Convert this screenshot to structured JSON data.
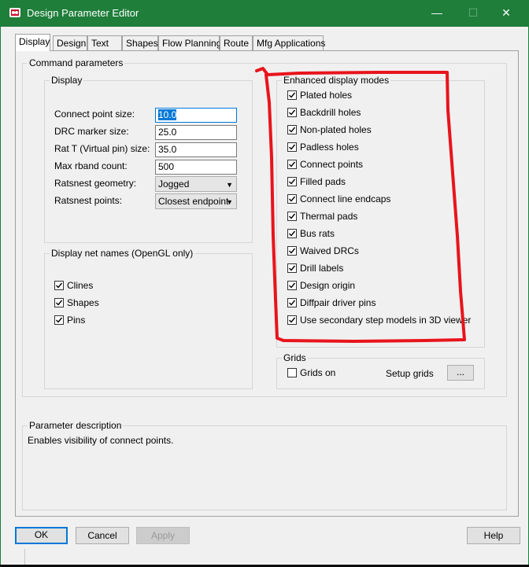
{
  "window": {
    "title": "Design Parameter Editor"
  },
  "tabs": [
    "Display",
    "Design",
    "Text",
    "Shapes",
    "Flow Planning",
    "Route",
    "Mfg Applications"
  ],
  "command_parameters": {
    "legend": "Command parameters",
    "display": {
      "legend": "Display",
      "fields": [
        {
          "label": "Connect point size:",
          "value": "10.0"
        },
        {
          "label": "DRC marker size:",
          "value": "25.0"
        },
        {
          "label": "Rat T (Virtual pin) size:",
          "value": "35.0"
        },
        {
          "label": "Max rband count:",
          "value": "500"
        },
        {
          "label": "Ratsnest geometry:",
          "value": "Jogged"
        },
        {
          "label": "Ratsnest points:",
          "value": "Closest endpoint"
        }
      ]
    },
    "net_names": {
      "legend": "Display net names (OpenGL only)",
      "items": [
        {
          "label": "Clines",
          "checked": true
        },
        {
          "label": "Shapes",
          "checked": true
        },
        {
          "label": "Pins",
          "checked": true
        }
      ]
    },
    "enhanced": {
      "legend": "Enhanced display modes",
      "items": [
        {
          "label": "Plated holes",
          "checked": true
        },
        {
          "label": "Backdrill holes",
          "checked": true
        },
        {
          "label": "Non-plated holes",
          "checked": true
        },
        {
          "label": "Padless holes",
          "checked": true
        },
        {
          "label": "Connect points",
          "checked": true
        },
        {
          "label": "Filled pads",
          "checked": true
        },
        {
          "label": "Connect line endcaps",
          "checked": true
        },
        {
          "label": "Thermal pads",
          "checked": true
        },
        {
          "label": "Bus rats",
          "checked": true
        },
        {
          "label": "Waived DRCs",
          "checked": true
        },
        {
          "label": "Drill labels",
          "checked": true
        },
        {
          "label": "Design origin",
          "checked": true
        },
        {
          "label": "Diffpair driver pins",
          "checked": true
        },
        {
          "label": "Use secondary step models in 3D viewer",
          "checked": true
        }
      ]
    },
    "grids": {
      "legend": "Grids",
      "grids_on_label": "Grids on",
      "grids_on_checked": false,
      "setup_label": "Setup grids",
      "setup_button": "..."
    }
  },
  "parameter_description": {
    "legend": "Parameter description",
    "text": "Enables visibility of connect points."
  },
  "buttons": {
    "ok": "OK",
    "cancel": "Cancel",
    "apply": "Apply",
    "help": "Help"
  },
  "colors": {
    "titlebar": "#1e7e3a",
    "annotation": "#e8141c",
    "focus": "#0078d7"
  }
}
